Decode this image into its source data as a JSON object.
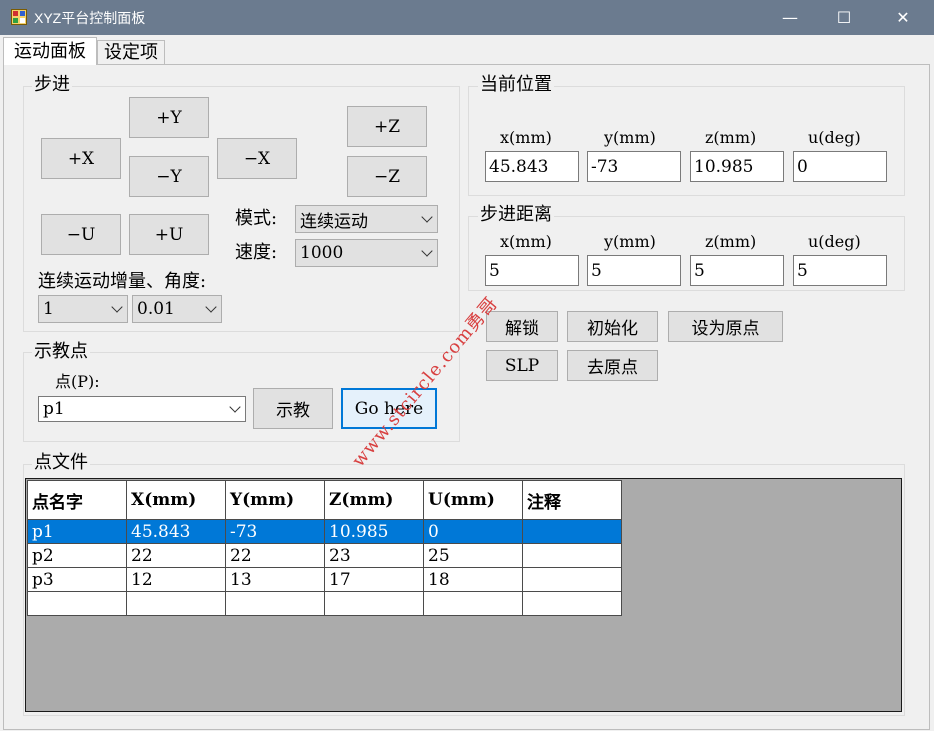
{
  "window": {
    "title": "XYZ平台控制面板",
    "minimize": "—",
    "maximize": "☐",
    "close": "✕"
  },
  "tabs": [
    {
      "label": "运动面板",
      "active": true
    },
    {
      "label": "设定项",
      "active": false
    }
  ],
  "step_group": {
    "title": "步进",
    "buttons": {
      "plus_y": "+Y",
      "minus_y": "−Y",
      "plus_x": "+X",
      "minus_x": "−X",
      "plus_z": "+Z",
      "minus_z": "−Z",
      "minus_u": "−U",
      "plus_u": "+U"
    },
    "mode_label": "模式:",
    "mode_value": "连续运动",
    "speed_label": "速度:",
    "speed_value": "1000",
    "increment_label": "连续运动增量、角度:",
    "increment_value": "1",
    "angle_value": "0.01"
  },
  "current_position": {
    "title": "当前位置",
    "x_label": "x(mm)",
    "y_label": "y(mm)",
    "z_label": "z(mm)",
    "u_label": "u(deg)",
    "x": "45.843",
    "y": "-73",
    "z": "10.985",
    "u": "0"
  },
  "step_distance": {
    "title": "步进距离",
    "x_label": "x(mm)",
    "y_label": "y(mm)",
    "z_label": "z(mm)",
    "u_label": "u(deg)",
    "x": "5",
    "y": "5",
    "z": "5",
    "u": "5"
  },
  "actions": {
    "unlock": "解锁",
    "initialize": "初始化",
    "set_origin": "设为原点",
    "slp": "SLP",
    "go_origin": "去原点"
  },
  "teach": {
    "title": "示教点",
    "point_label": "点(P):",
    "point_value": "p1",
    "teach_button": "示教",
    "go_here_button": "Go here"
  },
  "point_file": {
    "title": "点文件",
    "columns": [
      "点名字",
      "X(mm)",
      "Y(mm)",
      "Z(mm)",
      "U(mm)",
      "注释"
    ],
    "rows": [
      [
        "p1",
        "45.843",
        "-73",
        "10.985",
        "0",
        ""
      ],
      [
        "p2",
        "22",
        "22",
        "23",
        "25",
        ""
      ],
      [
        "p3",
        "12",
        "13",
        "17",
        "18",
        ""
      ],
      [
        "",
        "",
        "",
        "",
        "",
        ""
      ]
    ],
    "selected_row": 0
  },
  "watermark": "www.stcircle.com勇哥",
  "colors": {
    "titlebar": "#6b7b8f",
    "selection": "#0078d7",
    "grid_background": "#ababab",
    "watermark": "#d84040"
  }
}
